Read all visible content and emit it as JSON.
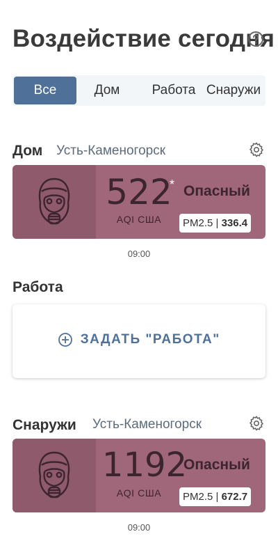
{
  "header": {
    "title": "Воздействие сегодня"
  },
  "filters": {
    "tabs": [
      {
        "label": "Все",
        "active": true
      },
      {
        "label": "Дом",
        "active": false
      },
      {
        "label": "Работа",
        "active": false
      },
      {
        "label": "Снаружи",
        "active": false
      }
    ]
  },
  "home": {
    "title": "Дом",
    "city": "Усть-Каменогорск",
    "aqi": "522",
    "aqi_note": "*",
    "aqi_unit": "AQI США",
    "status": "Опасный",
    "pm_label": "PM2.5 |",
    "pm_value": "336.4",
    "time": "09:00"
  },
  "work": {
    "title": "Работа",
    "add_label": "ЗАДАТЬ \"РАБОТА\""
  },
  "outside": {
    "title": "Снаружи",
    "city": "Усть-Каменогорск",
    "aqi": "1192",
    "aqi_unit": "AQI США",
    "status": "Опасный",
    "pm_label": "PM2.5 |",
    "pm_value": "672.7",
    "time": "09:00"
  },
  "colors": {
    "accent": "#4f7199",
    "hazardous": "#a06679",
    "hazardous_dark": "#8f5a6c"
  },
  "icons": {
    "help": "help-icon",
    "settings": "gear-icon",
    "face": "gas-mask-icon",
    "add": "plus-circle-icon"
  }
}
